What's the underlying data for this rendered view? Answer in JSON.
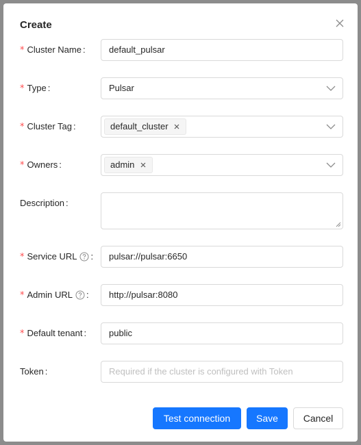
{
  "modal": {
    "title": "Create"
  },
  "fields": {
    "cluster_name": {
      "label": "Cluster Name",
      "value": "default_pulsar"
    },
    "type": {
      "label": "Type",
      "value": "Pulsar"
    },
    "cluster_tag": {
      "label": "Cluster Tag",
      "tags": [
        "default_cluster"
      ]
    },
    "owners": {
      "label": "Owners",
      "tags": [
        "admin"
      ]
    },
    "description": {
      "label": "Description",
      "value": ""
    },
    "service_url": {
      "label": "Service URL",
      "value": "pulsar://pulsar:6650"
    },
    "admin_url": {
      "label": "Admin URL",
      "value": "http://pulsar:8080"
    },
    "default_tenant": {
      "label": "Default tenant",
      "value": "public"
    },
    "token": {
      "label": "Token",
      "value": "",
      "placeholder": "Required if the cluster is configured with Token"
    }
  },
  "common": {
    "required_mark": "*",
    "colon": ":",
    "tag_close": "×"
  },
  "buttons": {
    "test_connection": "Test connection",
    "save": "Save",
    "cancel": "Cancel"
  },
  "colors": {
    "primary": "#1677ff",
    "required": "#ff4d4f",
    "border": "#d9d9d9"
  }
}
